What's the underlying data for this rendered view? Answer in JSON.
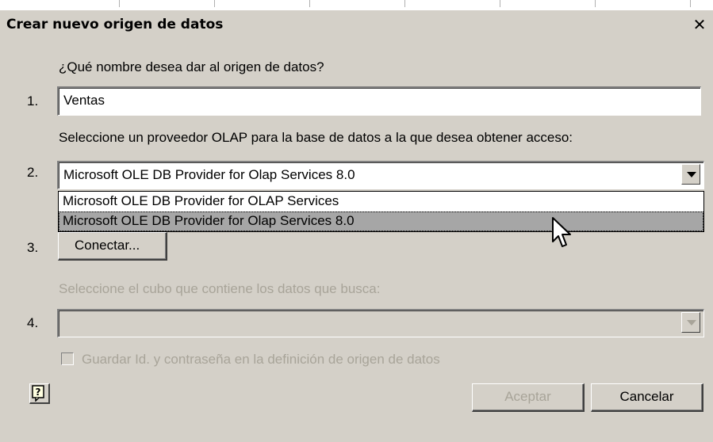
{
  "dialog": {
    "title": "Crear nuevo origen de datos",
    "close_glyph": "✕"
  },
  "step1": {
    "number": "1.",
    "question": "¿Qué nombre desea dar al origen de datos?",
    "name_value": "Ventas"
  },
  "step2": {
    "number": "2.",
    "question": "Seleccione un proveedor OLAP para la base de datos a la que desea obtener acceso:",
    "selected_provider": "Microsoft OLE DB Provider for Olap Services 8.0",
    "options": [
      "Microsoft OLE DB Provider for OLAP Services",
      "Microsoft OLE DB Provider for Olap Services 8.0"
    ],
    "highlighted_index": 1
  },
  "step3": {
    "number": "3.",
    "connect_label": "Conectar..."
  },
  "step4": {
    "number": "4.",
    "question": "Seleccione el cubo que contiene los datos que busca:",
    "cube_value": ""
  },
  "save_credentials": {
    "label": "Guardar Id. y contraseña en la definición de origen de datos",
    "checked": false
  },
  "footer": {
    "ok_label": "Aceptar",
    "cancel_label": "Cancelar",
    "help_icon": "question-mark-icon"
  },
  "colors": {
    "face": "#d4d0c8",
    "disabled_text": "#a8a499",
    "highlight": "#a6a6a6"
  }
}
